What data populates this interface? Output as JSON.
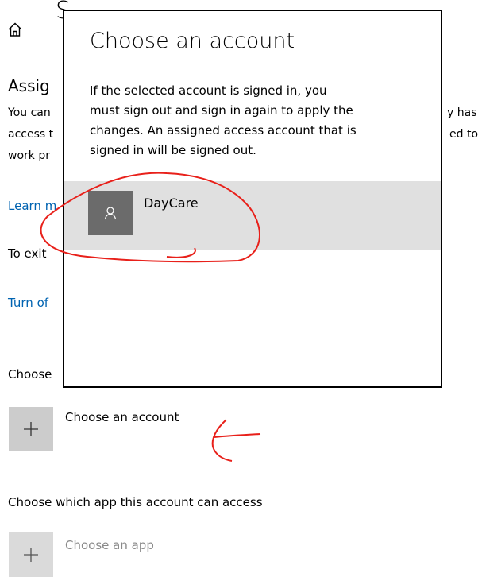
{
  "page": {
    "title_partial": "S",
    "section_heading_partial": "Assig",
    "description_lines": [
      "You can",
      "access t",
      "work pr"
    ],
    "right_fragments": [
      "y has",
      "ed to"
    ],
    "learn_more_partial": "Learn m",
    "exit_text_partial": "To exit",
    "turn_off_partial": "Turn of",
    "choose_partial": "Choose"
  },
  "choose_account": {
    "label": "Choose an account",
    "icon": "plus-icon"
  },
  "choose_app_section": {
    "heading": "Choose which app this account can access",
    "label": "Choose an app",
    "icon": "plus-icon"
  },
  "dialog": {
    "title": "Choose an account",
    "message_lines": [
      "If the selected account is signed in, you",
      "must sign out and sign in again to apply the",
      "changes. An assigned access account that is",
      "signed in will be signed out."
    ],
    "accounts": [
      {
        "name": "DayCare",
        "icon": "person-icon"
      }
    ]
  },
  "annotations": {
    "color": "#e8201a"
  }
}
